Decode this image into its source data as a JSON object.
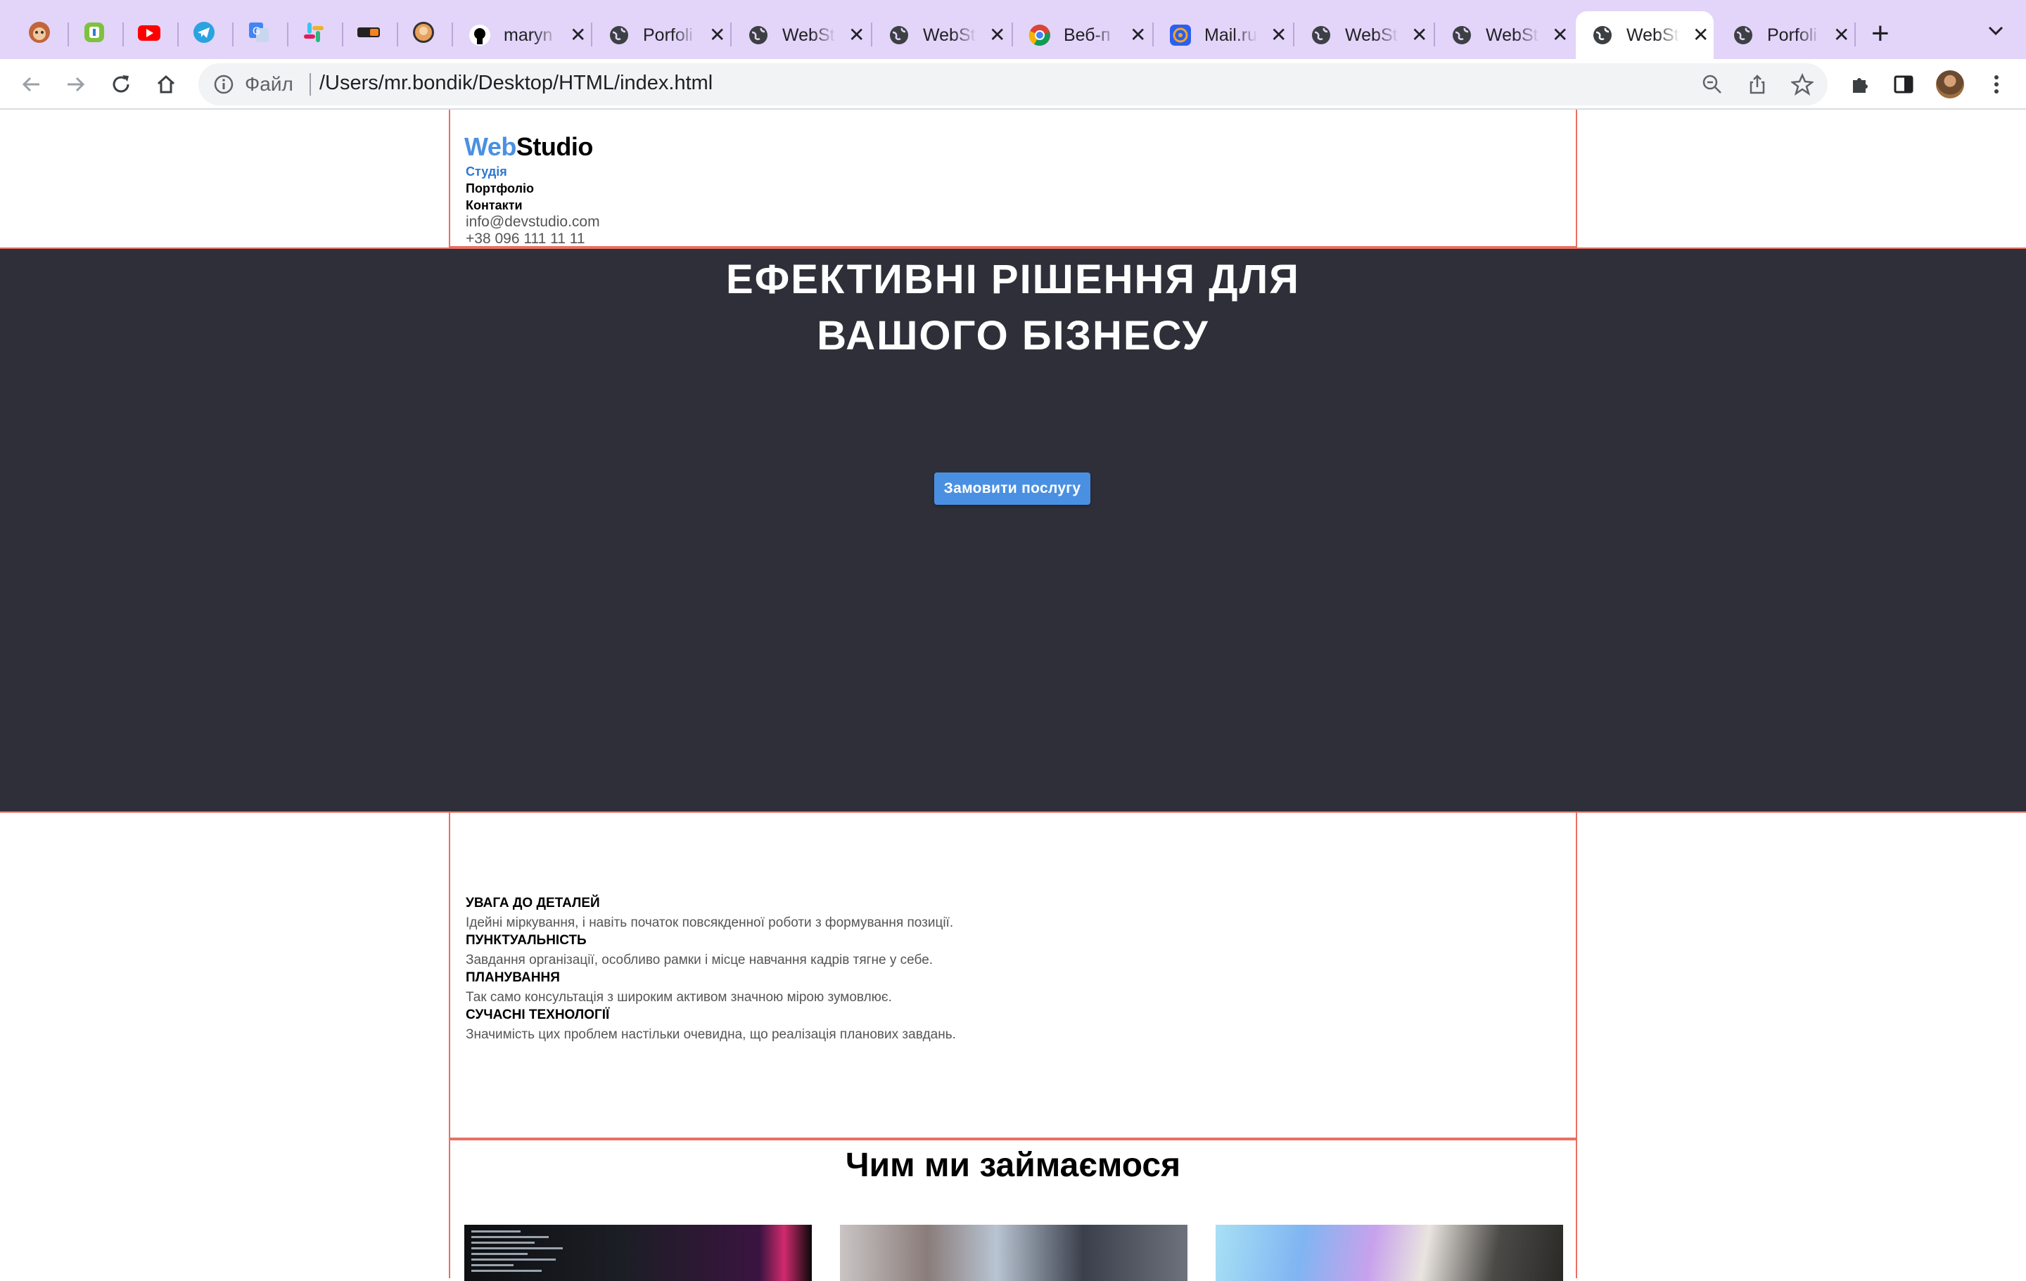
{
  "browser": {
    "tabs": [
      {
        "title": "maryn"
      },
      {
        "title": "Porfoli"
      },
      {
        "title": "WebSt"
      },
      {
        "title": "WebSt"
      },
      {
        "title": "Веб-п"
      },
      {
        "title": "Mail.ru"
      },
      {
        "title": "WebSt"
      },
      {
        "title": "WebSt"
      },
      {
        "title": "WebSt"
      },
      {
        "title": "Porfoli"
      }
    ],
    "active_tab_index": 8,
    "address": {
      "scheme_label": "Файл",
      "url": "/Users/mr.bondik/Desktop/HTML/index.html"
    },
    "colors": {
      "tabbar": "#e3d4fa",
      "omnibox": "#f1f3f4"
    }
  },
  "site": {
    "logo": {
      "part1": "Web",
      "part2": "Studio"
    },
    "nav": [
      "Студія",
      "Портфоліо",
      "Контакти"
    ],
    "contacts": {
      "email": "info@devstudio.com",
      "phone": "+38 096 111 11 11"
    },
    "hero": {
      "title_line1": "Ефективні рішення для",
      "title_line2": "вашого бізнесу",
      "cta": "Замовити послугу"
    },
    "features": [
      {
        "heading": "Увага до деталей",
        "text": "Ідейні міркування, і навіть початок повсякденної роботи з формування позиції."
      },
      {
        "heading": "Пунктуальність",
        "text": "Завдання організації, особливо рамки і місце навчання кадрів тягне у себе."
      },
      {
        "heading": "Планування",
        "text": "Так само консультація з широким активом значною мірою зумовлює."
      },
      {
        "heading": "Сучасні технології",
        "text": "Значимість цих проблем настільки очевидна, що реалізація планових завдань."
      }
    ],
    "services_title": "Чим ми займаємося",
    "colors": {
      "accent": "#4a90e2",
      "hero_bg": "#2f2f39",
      "outline": "#e87062"
    }
  }
}
